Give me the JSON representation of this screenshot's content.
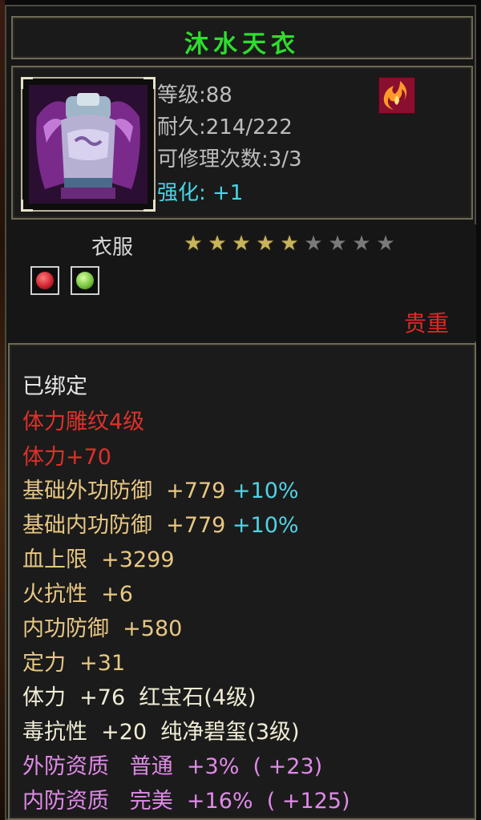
{
  "item": {
    "name": "沐水天衣",
    "stats": {
      "level": "等级:88",
      "durability": "耐久:214/222",
      "repairs": "可修理次数:3/3",
      "enhance": "强化: +1"
    },
    "category": "衣服",
    "stars": {
      "filled": 5,
      "total": 9
    },
    "rarity": "贵重",
    "gems": [
      {
        "name": "ruby-gem-icon",
        "color": "#c81e2a"
      },
      {
        "name": "jade-gem-icon",
        "color": "#6fbf3a"
      }
    ]
  },
  "attributes": [
    {
      "text": "已绑定",
      "color": "white"
    },
    {
      "text": "体力雕纹4级",
      "color": "red"
    },
    {
      "text": "体力+70",
      "color": "red"
    },
    {
      "text": "基础外功防御  +779 ",
      "extra": "+10%",
      "color": "gold"
    },
    {
      "text": "基础内功防御  +779 ",
      "extra": "+10%",
      "color": "gold"
    },
    {
      "text": "血上限  +3299",
      "color": "gold"
    },
    {
      "text": "火抗性  +6",
      "color": "gold"
    },
    {
      "text": "内功防御  +580",
      "color": "gold"
    },
    {
      "text": "定力  +31",
      "color": "gold"
    },
    {
      "text": "体力  +76  红宝石(4级)",
      "color": "ivory"
    },
    {
      "text": "毒抗性  +20  纯净碧玺(3级)",
      "color": "ivory"
    },
    {
      "text": "外防资质   普通  +3%  ( +23)",
      "color": "pink"
    },
    {
      "text": "内防资质   完美  +16%  ( +125)",
      "color": "pink"
    }
  ]
}
